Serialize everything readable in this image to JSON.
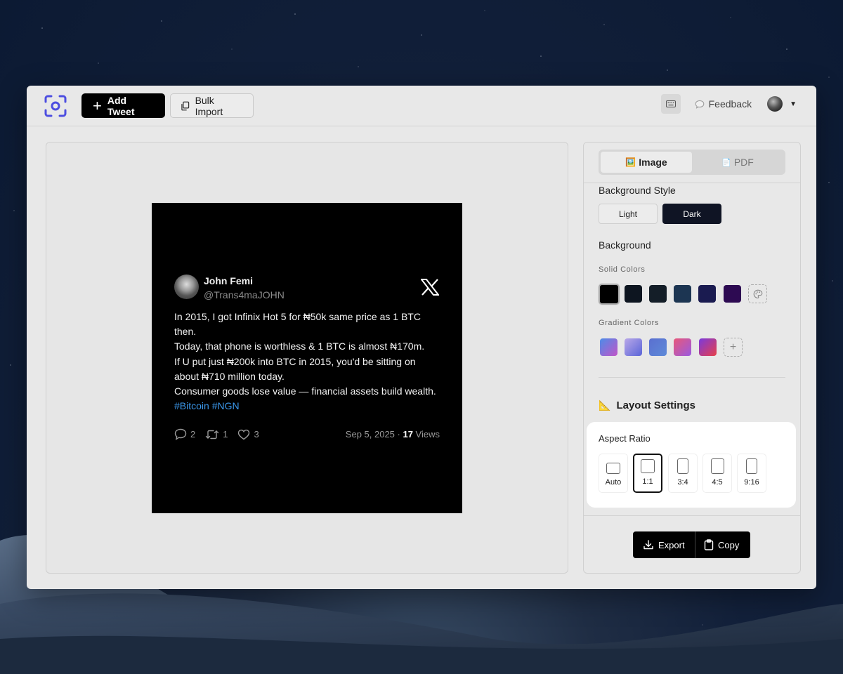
{
  "toolbar": {
    "add_tweet_label": "Add Tweet",
    "bulk_import_label": "Bulk Import",
    "feedback_label": "Feedback"
  },
  "tweet": {
    "name": "John Femi",
    "handle": "@Trans4maJOHN",
    "lines": [
      "In 2015, I got Infinix Hot 5 for ₦50k same price as 1 BTC",
      "then.",
      "Today, that phone is worthless & 1 BTC is almost ₦170m.",
      "If U put just ₦200k into BTC in 2015, you'd be sitting on",
      "about ₦710 million today.",
      "Consumer goods lose value — financial assets build wealth."
    ],
    "hashtags": "#Bitcoin #NGN",
    "replies": "2",
    "retweets": "1",
    "likes": "3",
    "date": "Sep 5, 2025 · ",
    "views_count": "17",
    "views_label": " Views"
  },
  "sidebar": {
    "tabs": [
      {
        "icon": "🖼️",
        "label": "Image"
      },
      {
        "icon": "📄",
        "label": "PDF"
      }
    ],
    "background_style_title": "Background Style",
    "style_options": [
      "Light",
      "Dark"
    ],
    "background_title": "Background",
    "solid_colors_label": "Solid Colors",
    "solid_colors": [
      "#000000",
      "#0d1520",
      "#141e28",
      "#1c3552",
      "#1a1b50",
      "#2d0a52"
    ],
    "gradient_colors_label": "Gradient Colors",
    "gradient_colors": [
      [
        "#4d8ce8",
        "#c255c8"
      ],
      [
        "#b9a8e8",
        "#5a64d8"
      ],
      [
        "#5a6fd0",
        "#5e8ad8"
      ],
      [
        "#e8587a",
        "#9a5ae0"
      ],
      [
        "#7a3adc",
        "#e8404a"
      ]
    ],
    "layout_settings_title": "Layout Settings",
    "aspect_ratio_title": "Aspect Ratio",
    "ratios": [
      "Auto",
      "1:1",
      "3:4",
      "4:5",
      "9:16"
    ],
    "export_label": "Export",
    "copy_label": "Copy"
  }
}
